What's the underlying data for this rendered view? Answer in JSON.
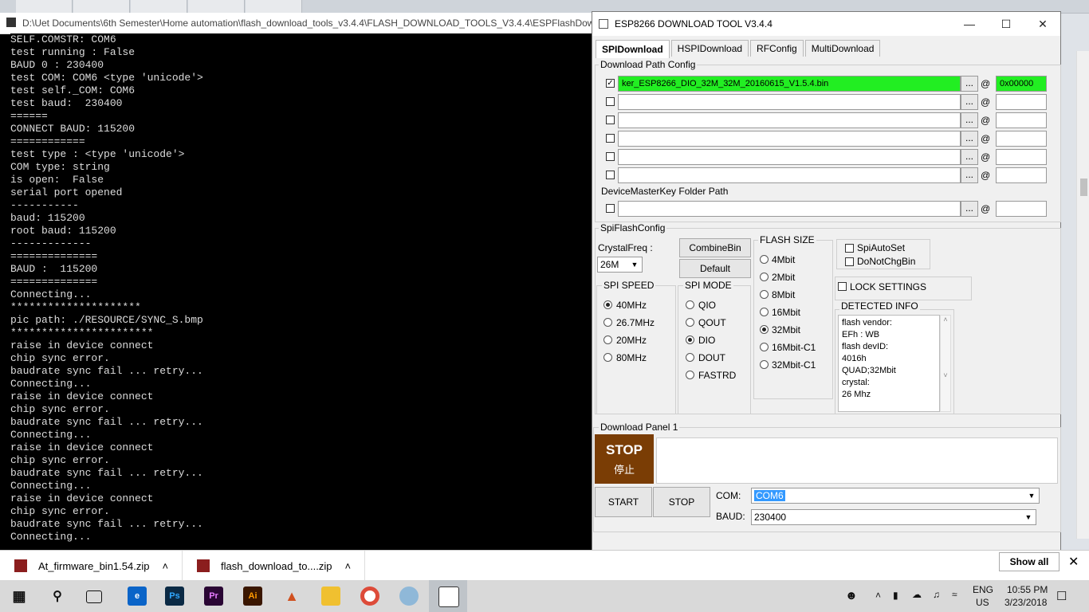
{
  "console": {
    "title": "D:\\Uet Documents\\6th Semester\\Home automation\\flash_download_tools_v3.4.4\\FLASH_DOWNLOAD_TOOLS_V3.4.4\\ESPFlashDown",
    "lines": "SELF.COMSTR: COM6\ntest running : False\nBAUD 0 : 230400\ntest COM: COM6 <type 'unicode'>\ntest self._COM: COM6\ntest baud:  230400\n======\nCONNECT BAUD: 115200\n============\ntest type : <type 'unicode'>\nCOM type: string\nis open:  False\nserial port opened\n-----------\nbaud: 115200\nroot baud: 115200\n-------------\n==============\nBAUD :  115200\n==============\nConnecting...\n*********************\npic path: ./RESOURCE/SYNC_S.bmp\n***********************\nraise in device connect\nchip sync error.\nbaudrate sync fail ... retry...\nConnecting...\nraise in device connect\nchip sync error.\nbaudrate sync fail ... retry...\nConnecting...\nraise in device connect\nchip sync error.\nbaudrate sync fail ... retry...\nConnecting...\nraise in device connect\nchip sync error.\nbaudrate sync fail ... retry...\nConnecting..."
  },
  "tool": {
    "title": "ESP8266 DOWNLOAD TOOL V3.4.4",
    "tabs": [
      "SPIDownload",
      "HSPIDownload",
      "RFConfig",
      "MultiDownload"
    ],
    "download_path_label": "Download Path Config",
    "paths": [
      {
        "checked": true,
        "file": "ker_ESP8266_DIO_32M_32M_20160615_V1.5.4.bin",
        "addr": "0x00000"
      },
      {
        "checked": false,
        "file": "",
        "addr": ""
      },
      {
        "checked": false,
        "file": "",
        "addr": ""
      },
      {
        "checked": false,
        "file": "",
        "addr": ""
      },
      {
        "checked": false,
        "file": "",
        "addr": ""
      },
      {
        "checked": false,
        "file": "",
        "addr": ""
      }
    ],
    "dots": "...",
    "at": "@",
    "master_key_label": "DeviceMasterKey Folder Path",
    "spi_flash_config": "SpiFlashConfig",
    "crystal_label": "CrystalFreq :",
    "crystal_value": "26M",
    "combine_bin": "CombineBin",
    "default": "Default",
    "flash_size_label": "FLASH SIZE",
    "flash_sizes": [
      "4Mbit",
      "2Mbit",
      "8Mbit",
      "16Mbit",
      "32Mbit",
      "16Mbit-C1",
      "32Mbit-C1"
    ],
    "flash_selected": "32Mbit",
    "spi_auto_set": "SpiAutoSet",
    "do_not_chg_bin": "DoNotChgBin",
    "lock_settings": "LOCK SETTINGS",
    "spi_speed_label": "SPI SPEED",
    "spi_speeds": [
      "40MHz",
      "26.7MHz",
      "20MHz",
      "80MHz"
    ],
    "speed_selected": "40MHz",
    "spi_mode_label": "SPI MODE",
    "spi_modes": [
      "QIO",
      "QOUT",
      "DIO",
      "DOUT",
      "FASTRD"
    ],
    "mode_selected": "DIO",
    "detected_label": "DETECTED INFO",
    "detected_info": "flash vendor:\nEFh : WB\nflash devID:\n4016h\nQUAD;32Mbit\ncrystal:\n26 Mhz",
    "download_panel": "Download Panel 1",
    "stop_big": "STOP",
    "stop_small": "停止",
    "start_btn": "START",
    "stop_btn": "STOP",
    "com_label": "COM:",
    "com_value": "COM6",
    "baud_label": "BAUD:",
    "baud_value": "230400"
  },
  "downloads": {
    "items": [
      "At_firmware_bin1.54.zip",
      "flash_download_to....zip"
    ],
    "show_all": "Show all"
  },
  "taskbar": {
    "icons": [
      "start-icon",
      "search-icon",
      "task-view-icon",
      "edge-icon",
      "photoshop-icon",
      "premiere-icon",
      "illustrator-icon",
      "matlab-icon",
      "file-explorer-icon",
      "chrome-icon",
      "paint-icon",
      "esp-tool-icon"
    ],
    "lang_top": "ENG",
    "lang_bottom": "US",
    "time": "10:55 PM",
    "date": "3/23/2018"
  }
}
